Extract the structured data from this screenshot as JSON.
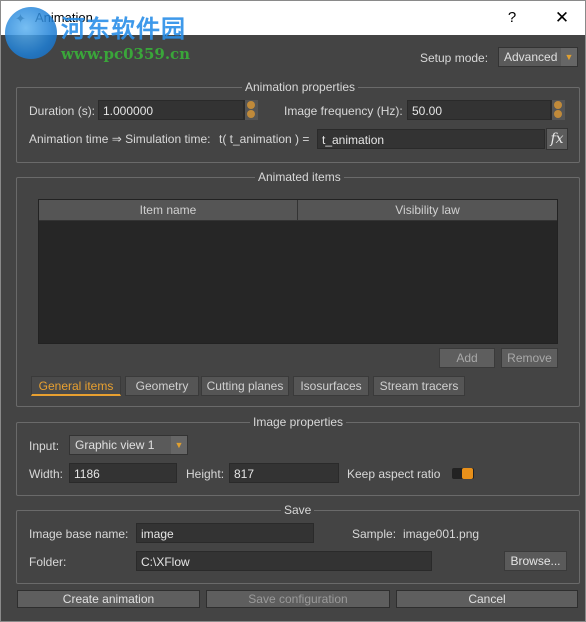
{
  "titlebar": {
    "title": "Animation",
    "help": "?",
    "close": "✕"
  },
  "watermark": {
    "site_name": "河东软件园",
    "url": "www.pc0359.cn"
  },
  "setup": {
    "label": "Setup mode:",
    "value": "Advanced"
  },
  "animation_properties": {
    "title": "Animation properties",
    "duration_label": "Duration (s):",
    "duration_value": "1.000000",
    "frequency_label": "Image frequency (Hz):",
    "frequency_value": "50.00",
    "time_label": "Animation time ⇒ Simulation time:",
    "time_formula_label": "t( t_animation ) =",
    "time_formula_value": "t_animation",
    "fx_label": "fx"
  },
  "animated_items": {
    "title": "Animated items",
    "columns": [
      "Item name",
      "Visibility law"
    ],
    "rows": [],
    "add_label": "Add",
    "remove_label": "Remove",
    "tabs": [
      {
        "label": "General items",
        "active": true
      },
      {
        "label": "Geometry",
        "active": false
      },
      {
        "label": "Cutting planes",
        "active": false
      },
      {
        "label": "Isosurfaces",
        "active": false
      },
      {
        "label": "Stream tracers",
        "active": false
      }
    ]
  },
  "image_properties": {
    "title": "Image properties",
    "input_label": "Input:",
    "input_value": "Graphic view 1",
    "width_label": "Width:",
    "width_value": "1186",
    "height_label": "Height:",
    "height_value": "817",
    "aspect_label": "Keep aspect ratio",
    "aspect_on": true
  },
  "save": {
    "title": "Save",
    "base_name_label": "Image base name:",
    "base_name_value": "image",
    "sample_label": "Sample:",
    "sample_value": "image001.png",
    "folder_label": "Folder:",
    "folder_value": "C:\\XFlow",
    "browse_label": "Browse..."
  },
  "footer": {
    "create_label": "Create animation",
    "save_config_label": "Save configuration",
    "cancel_label": "Cancel"
  },
  "colors": {
    "background": "#444444",
    "accent": "#e8901a",
    "field": "#333333"
  }
}
